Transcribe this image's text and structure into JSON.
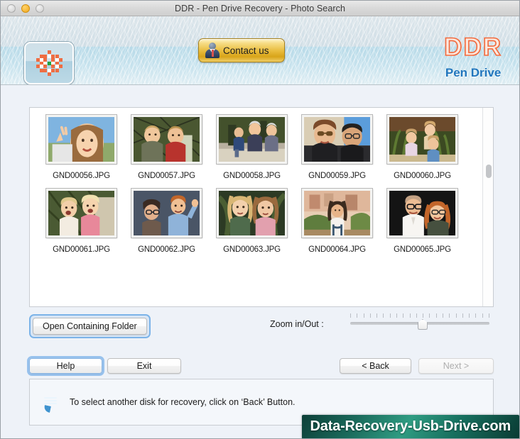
{
  "window": {
    "title": "DDR - Pen Drive Recovery - Photo Search",
    "traffic_lights": [
      "close",
      "minimize",
      "zoom"
    ]
  },
  "header": {
    "app_icon_name": "ddr-app-icon",
    "contact_button": "Contact us",
    "brand_primary": "DDR",
    "brand_secondary": "Pen Drive",
    "brand_primary_color": "#f2693c",
    "brand_secondary_color": "#2176bd"
  },
  "thumbnails": {
    "rows": [
      [
        {
          "name": "GND00056.JPG"
        },
        {
          "name": "GND00057.JPG"
        },
        {
          "name": "GND00058.JPG"
        },
        {
          "name": "GND00059.JPG"
        },
        {
          "name": "GND00060.JPG"
        }
      ],
      [
        {
          "name": "GND00061.JPG"
        },
        {
          "name": "GND00062.JPG"
        },
        {
          "name": "GND00063.JPG"
        },
        {
          "name": "GND00064.JPG"
        },
        {
          "name": "GND00065.JPG"
        }
      ]
    ]
  },
  "controls": {
    "open_folder": "Open Containing Folder",
    "zoom_label": "Zoom in/Out :",
    "zoom_value_percent": 52,
    "zoom_tick_count": 22
  },
  "buttons": {
    "help": "Help",
    "exit": "Exit",
    "back": "< Back",
    "next": "Next >"
  },
  "status": {
    "icon": "speech-bubble-icon",
    "message": "To select another disk for recovery, click on ‘Back’ Button."
  },
  "watermark": {
    "text": "Data-Recovery-Usb-Drive.com"
  }
}
